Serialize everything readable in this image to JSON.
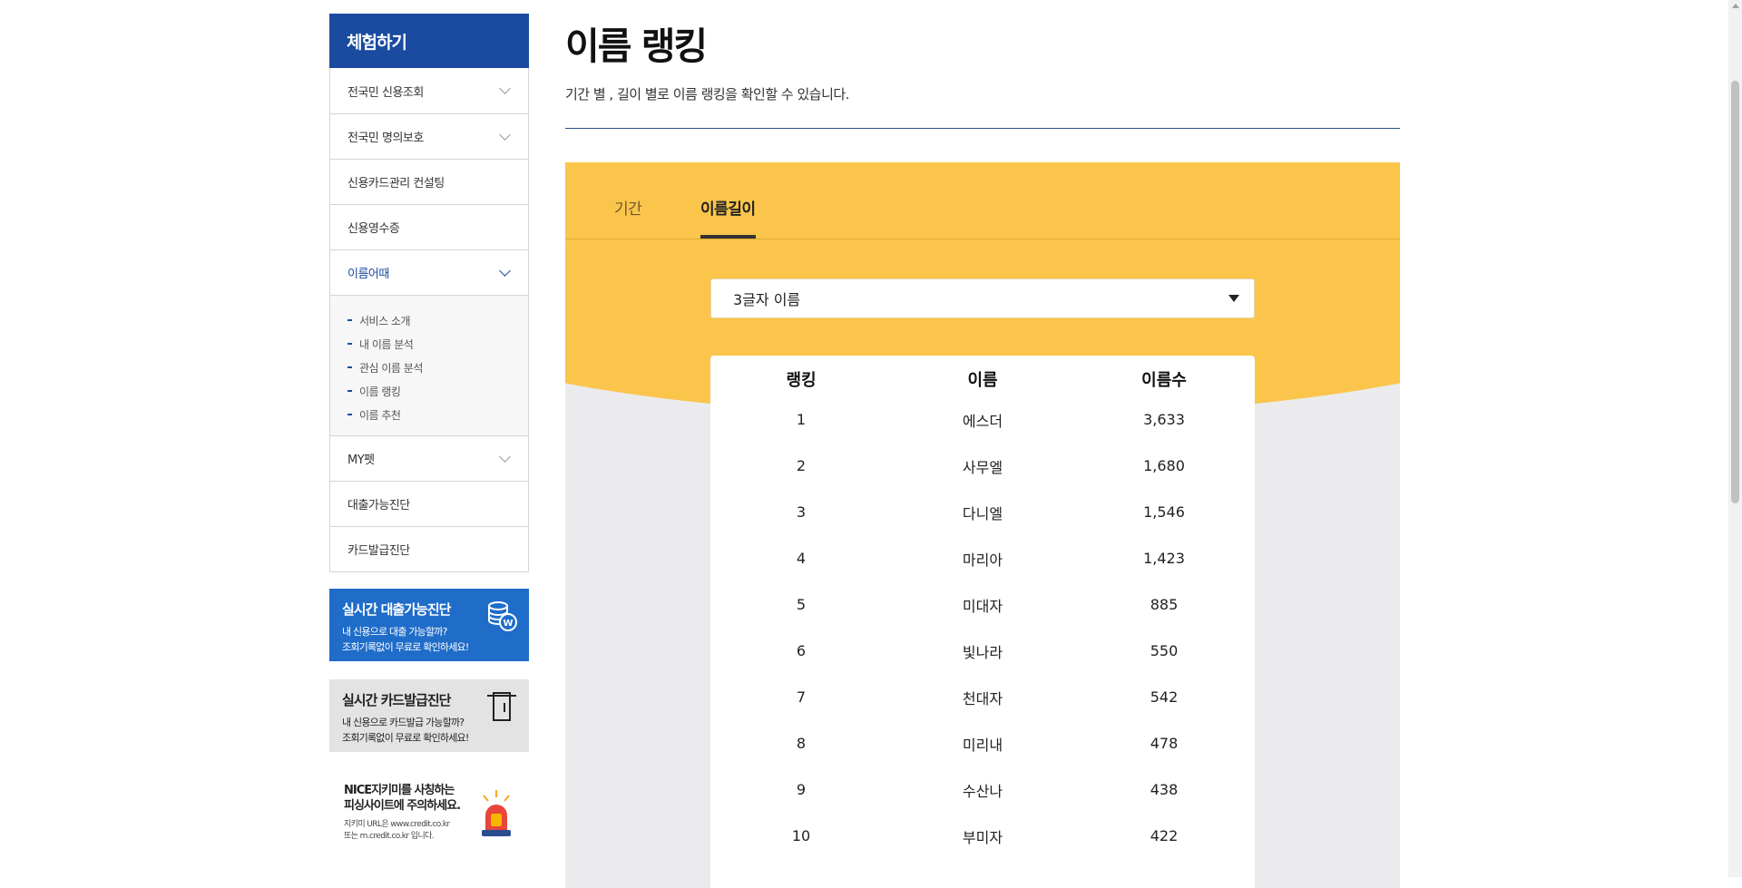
{
  "sidebar": {
    "title": "체험하기",
    "items": [
      {
        "label": "전국민 신용조회"
      },
      {
        "label": "전국민 명의보호"
      },
      {
        "label": "신용카드관리 컨설팅"
      },
      {
        "label": "신용영수증"
      },
      {
        "label": "이름어때"
      },
      {
        "label": "MY펫"
      },
      {
        "label": "대출가능진단"
      },
      {
        "label": "카드발급진단"
      }
    ],
    "sub_items": [
      {
        "label": "서비스 소개"
      },
      {
        "label": "내 이름 분석"
      },
      {
        "label": "관심 이름 분석"
      },
      {
        "label": "이름 랭킹"
      },
      {
        "label": "이름 추천"
      }
    ]
  },
  "banners": {
    "loan": {
      "title": "실시간 대출가능진단",
      "desc1": "내 신용으로 대출 가능할까?",
      "desc2": "조회기록없이 무료로 확인하세요!",
      "icon": "coin-stack-icon"
    },
    "card": {
      "title": "실시간 카드발급진단",
      "desc1": "내 신용으로 카드발급 가능할까?",
      "desc2": "조회기록없이 무료로 확인하세요!",
      "icon": "card-slot-icon"
    },
    "phishing": {
      "title1": "NICE지키미를 사칭하는",
      "title2": "피싱사이트에 주의하세요.",
      "desc1": "지키미 URL은 www.credit.co.kr",
      "desc2": "또는 m.credit.co.kr 입니다.",
      "icon": "siren-icon"
    }
  },
  "main": {
    "title": "이름 랭킹",
    "description": "기간 별 , 길이 별로 이름 랭킹을 확인할 수 있습니다.",
    "tabs": [
      {
        "label": "기간"
      },
      {
        "label": "이름길이"
      }
    ],
    "select": {
      "value": "3글자 이름"
    },
    "table": {
      "headers": [
        "랭킹",
        "이름",
        "이름수"
      ],
      "rows": [
        [
          "1",
          "에스더",
          "3,633"
        ],
        [
          "2",
          "사무엘",
          "1,680"
        ],
        [
          "3",
          "다니엘",
          "1,546"
        ],
        [
          "4",
          "마리아",
          "1,423"
        ],
        [
          "5",
          "미대자",
          "885"
        ],
        [
          "6",
          "빛나라",
          "550"
        ],
        [
          "7",
          "천대자",
          "542"
        ],
        [
          "8",
          "미리내",
          "478"
        ],
        [
          "9",
          "수산나",
          "438"
        ],
        [
          "10",
          "부미자",
          "422"
        ]
      ]
    }
  },
  "colors": {
    "brand_blue": "#1a4ba0",
    "banner_blue": "#1f6dc9",
    "accent_yellow": "#fbc54c"
  }
}
